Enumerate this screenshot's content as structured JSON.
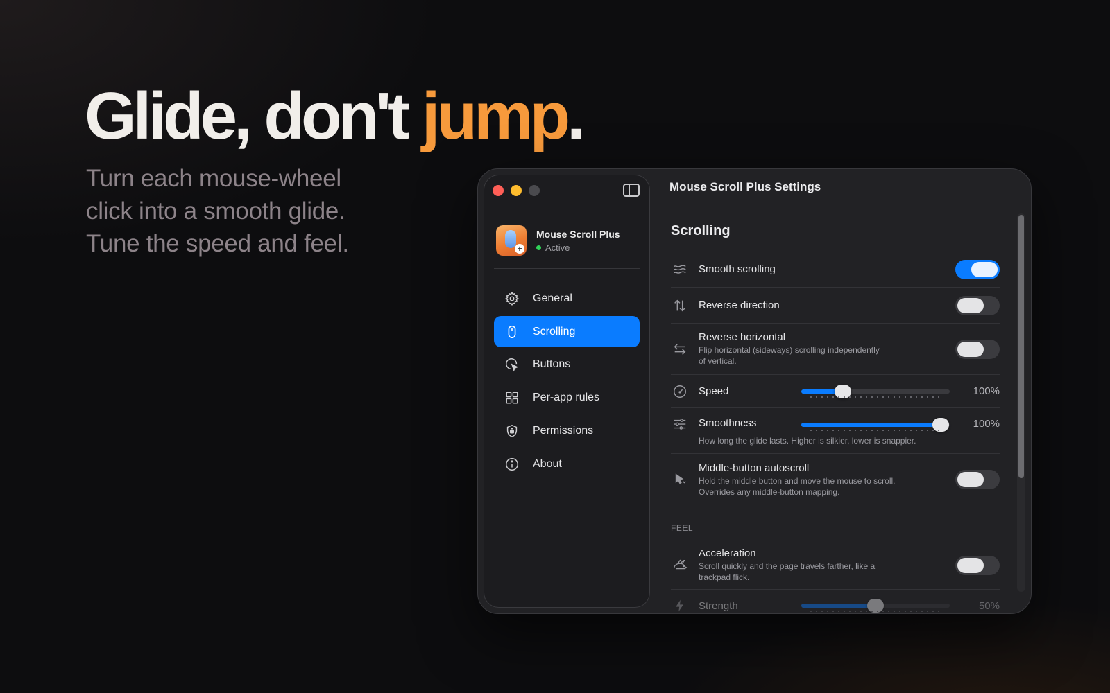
{
  "hero": {
    "title_main": "Glide, don't ",
    "title_accent": "jump",
    "title_end": ".",
    "subtitle_line1": "Turn each mouse-wheel",
    "subtitle_line2": "click into a smooth glide.",
    "subtitle_line3": "Tune the speed and feel."
  },
  "window": {
    "title": "Mouse Scroll Plus Settings"
  },
  "sidebar": {
    "app_name": "Mouse Scroll Plus",
    "app_status": "Active",
    "items": [
      {
        "label": "General",
        "icon": "gear-icon"
      },
      {
        "label": "Scrolling",
        "icon": "mouse-icon",
        "active": true
      },
      {
        "label": "Buttons",
        "icon": "cursor-click-icon"
      },
      {
        "label": "Per-app rules",
        "icon": "grid-icon"
      },
      {
        "label": "Permissions",
        "icon": "shield-lock-icon"
      },
      {
        "label": "About",
        "icon": "info-icon"
      }
    ]
  },
  "scrolling": {
    "section_title": "Scrolling",
    "smooth_scrolling": {
      "label": "Smooth scrolling",
      "enabled": true
    },
    "reverse_direction": {
      "label": "Reverse direction",
      "enabled": false
    },
    "reverse_horizontal": {
      "label": "Reverse horizontal",
      "desc_line1": "Flip horizontal (sideways) scrolling independently",
      "desc_line2": "of vertical.",
      "enabled": false
    },
    "speed": {
      "label": "Speed",
      "value": 0.28,
      "display": "100%"
    },
    "smoothness": {
      "label": "Smoothness",
      "value": 0.94,
      "display": "100%",
      "desc": "How long the glide lasts. Higher is silkier, lower is snappier."
    },
    "middle_autoscroll": {
      "label": "Middle-button autoscroll",
      "desc_line1": "Hold the middle button and move the mouse to scroll.",
      "desc_line2": "Overrides any middle-button mapping.",
      "enabled": false
    }
  },
  "feel": {
    "header": "FEEL",
    "acceleration": {
      "label": "Acceleration",
      "desc_line1": "Scroll quickly and the page travels farther, like a",
      "desc_line2": "trackpad flick.",
      "enabled": false
    },
    "strength": {
      "label": "Strength",
      "value": 0.5,
      "display": "50%"
    }
  },
  "colors": {
    "accent": "#f79a3c",
    "brand_blue": "#0a7cff",
    "status_green": "#30d158"
  }
}
